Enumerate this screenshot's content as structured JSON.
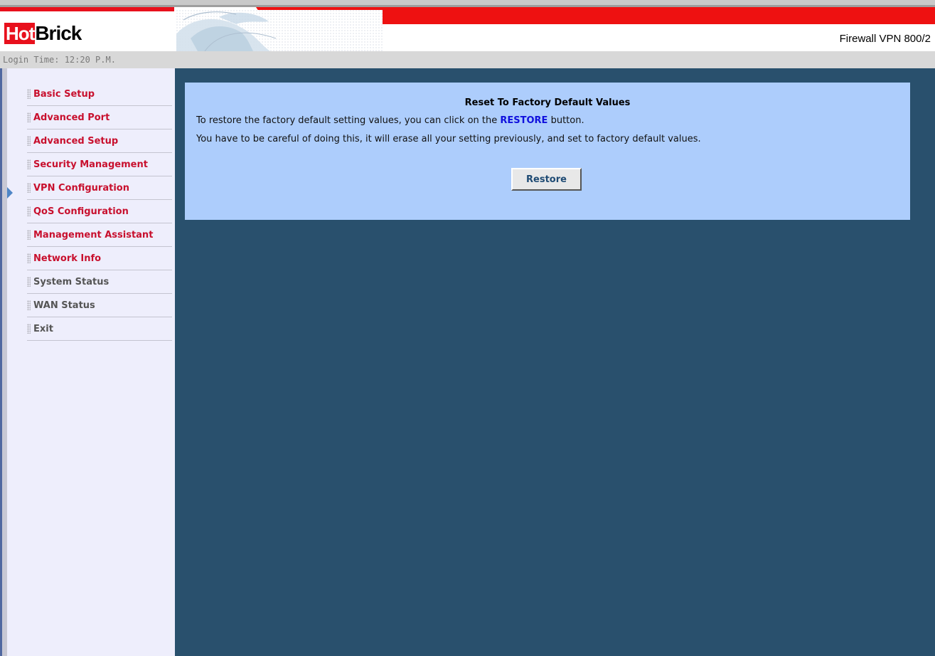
{
  "brand": {
    "logo_part1": "Hot",
    "logo_part2": "Brick",
    "product": "Firewall VPN 800/2"
  },
  "login_time": "Login Time: 12:20 P.M.",
  "sidebar": {
    "items": [
      {
        "label": "Basic Setup"
      },
      {
        "label": "Advanced Port"
      },
      {
        "label": "Advanced Setup"
      },
      {
        "label": "Security Management"
      },
      {
        "label": "VPN Configuration"
      },
      {
        "label": "QoS Configuration"
      },
      {
        "label": "Management Assistant"
      },
      {
        "label": "Network Info"
      },
      {
        "label": "System Status"
      },
      {
        "label": "WAN Status"
      },
      {
        "label": "Exit"
      }
    ],
    "active": "Network Info"
  },
  "main": {
    "title": "Reset To Factory Default Values",
    "line1_before": "To restore the factory default setting values, you can click on the ",
    "line1_keyword": "RESTORE",
    "line1_after": " button.",
    "line2": "You have to be careful of doing this, it will erase all your setting previously, and set to factory default values.",
    "restore_button": "Restore"
  },
  "colors": {
    "brand_red": "#e8101c",
    "menu_red": "#c8102e",
    "menu_gray": "#555555",
    "main_bg": "#29506d",
    "panel_bg": "#adcdfc",
    "keyword_blue": "#1010dd"
  }
}
